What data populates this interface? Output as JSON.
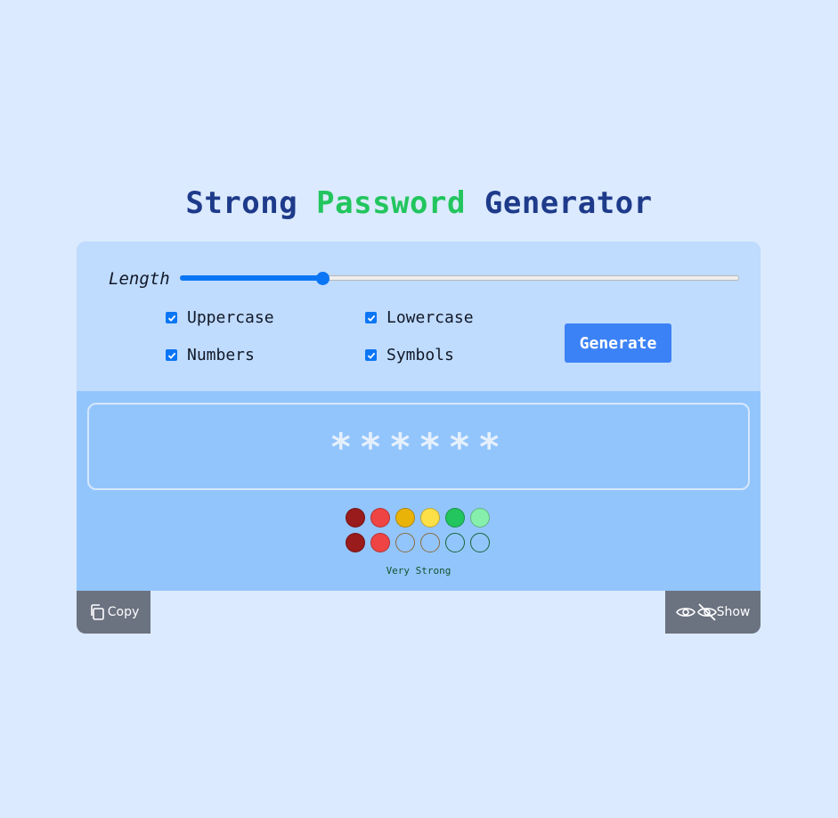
{
  "title": {
    "part1": "Strong ",
    "part2": "Password",
    "part3": " Generator"
  },
  "length": {
    "label": "Length",
    "value_fraction": 0.255
  },
  "options": {
    "uppercase": {
      "label": "Uppercase",
      "checked": true
    },
    "lowercase": {
      "label": "Lowercase",
      "checked": true
    },
    "numbers": {
      "label": "Numbers",
      "checked": true
    },
    "symbols": {
      "label": "Symbols",
      "checked": true
    }
  },
  "generate_label": "Generate",
  "password_display": "******",
  "strength": {
    "label": "Very Strong",
    "level_colors": [
      "#991b1b",
      "#ef4444",
      "#eab308",
      "#fde047",
      "#22c55e",
      "#86efac"
    ],
    "second_row_filled": 2
  },
  "actions": {
    "copy_label": "Copy",
    "show_label": "Show"
  },
  "colors": {
    "accent": "#3b82f6",
    "title": "#1e3a8a",
    "title_accent": "#22c55e"
  }
}
